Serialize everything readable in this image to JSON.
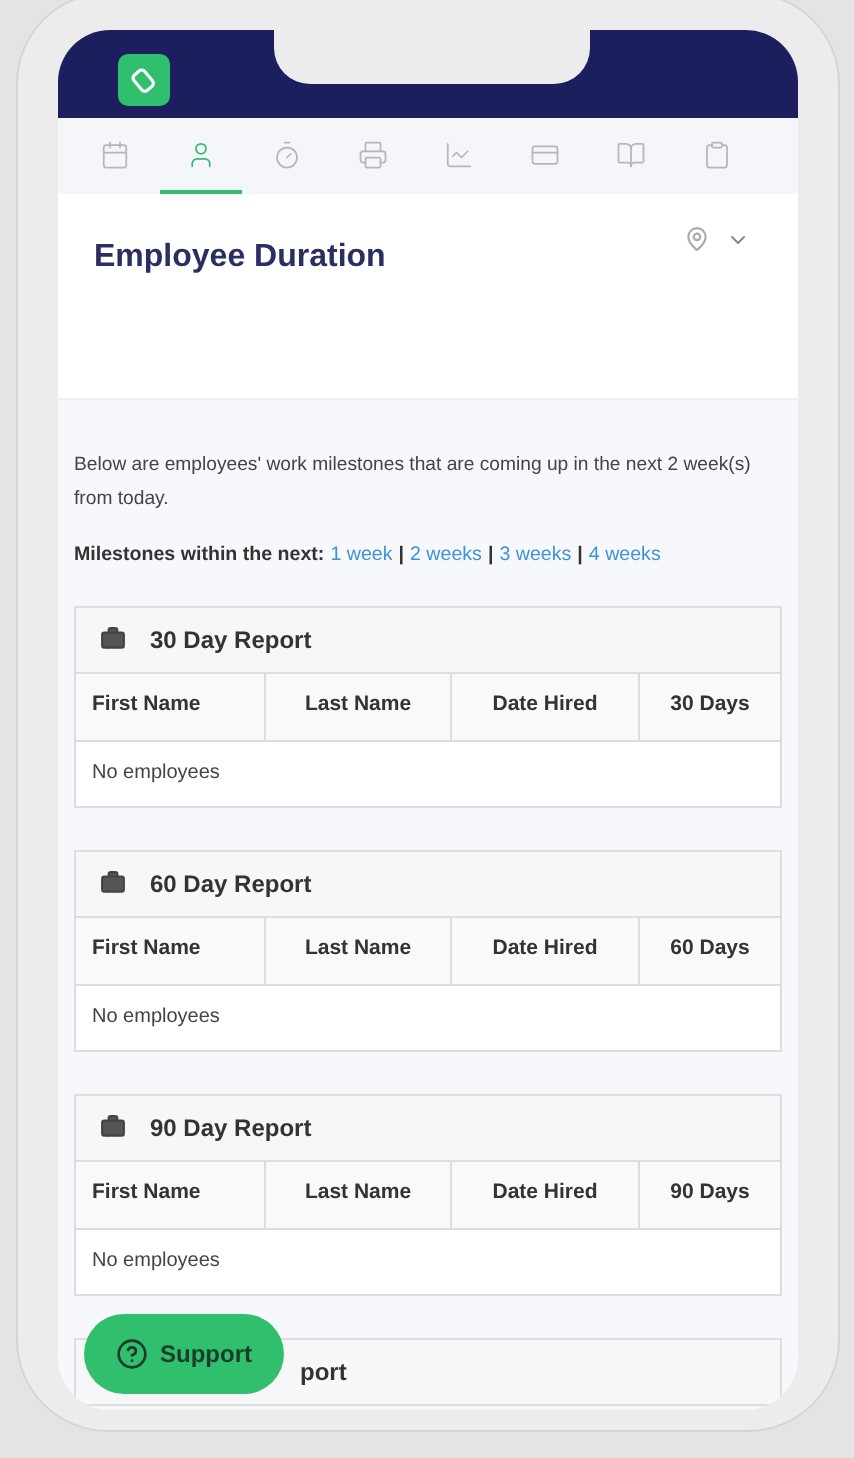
{
  "tabs": [
    {
      "selected": false
    },
    {
      "selected": true
    },
    {
      "selected": false
    },
    {
      "selected": false
    },
    {
      "selected": false
    },
    {
      "selected": false
    },
    {
      "selected": false
    },
    {
      "selected": false
    }
  ],
  "page_title": "Employee Duration",
  "intro": "Below are employees' work milestones that are coming up in the next 2 week(s) from today.",
  "milestones": {
    "label": "Milestones within the next:",
    "separator": "|",
    "links": [
      "1 week",
      "2 weeks",
      "3 weeks",
      "4 weeks"
    ]
  },
  "reports": [
    {
      "title": "30 Day Report",
      "columns": [
        "First Name",
        "Last Name",
        "Date Hired",
        "30 Days"
      ],
      "empty": "No employees"
    },
    {
      "title": "60 Day Report",
      "columns": [
        "First Name",
        "Last Name",
        "Date Hired",
        "60 Days"
      ],
      "empty": "No employees"
    },
    {
      "title": "90 Day Report",
      "columns": [
        "First Name",
        "Last Name",
        "Date Hired",
        "90 Days"
      ],
      "empty": "No employees"
    },
    {
      "title": "port"
    }
  ],
  "support_button": "Support"
}
